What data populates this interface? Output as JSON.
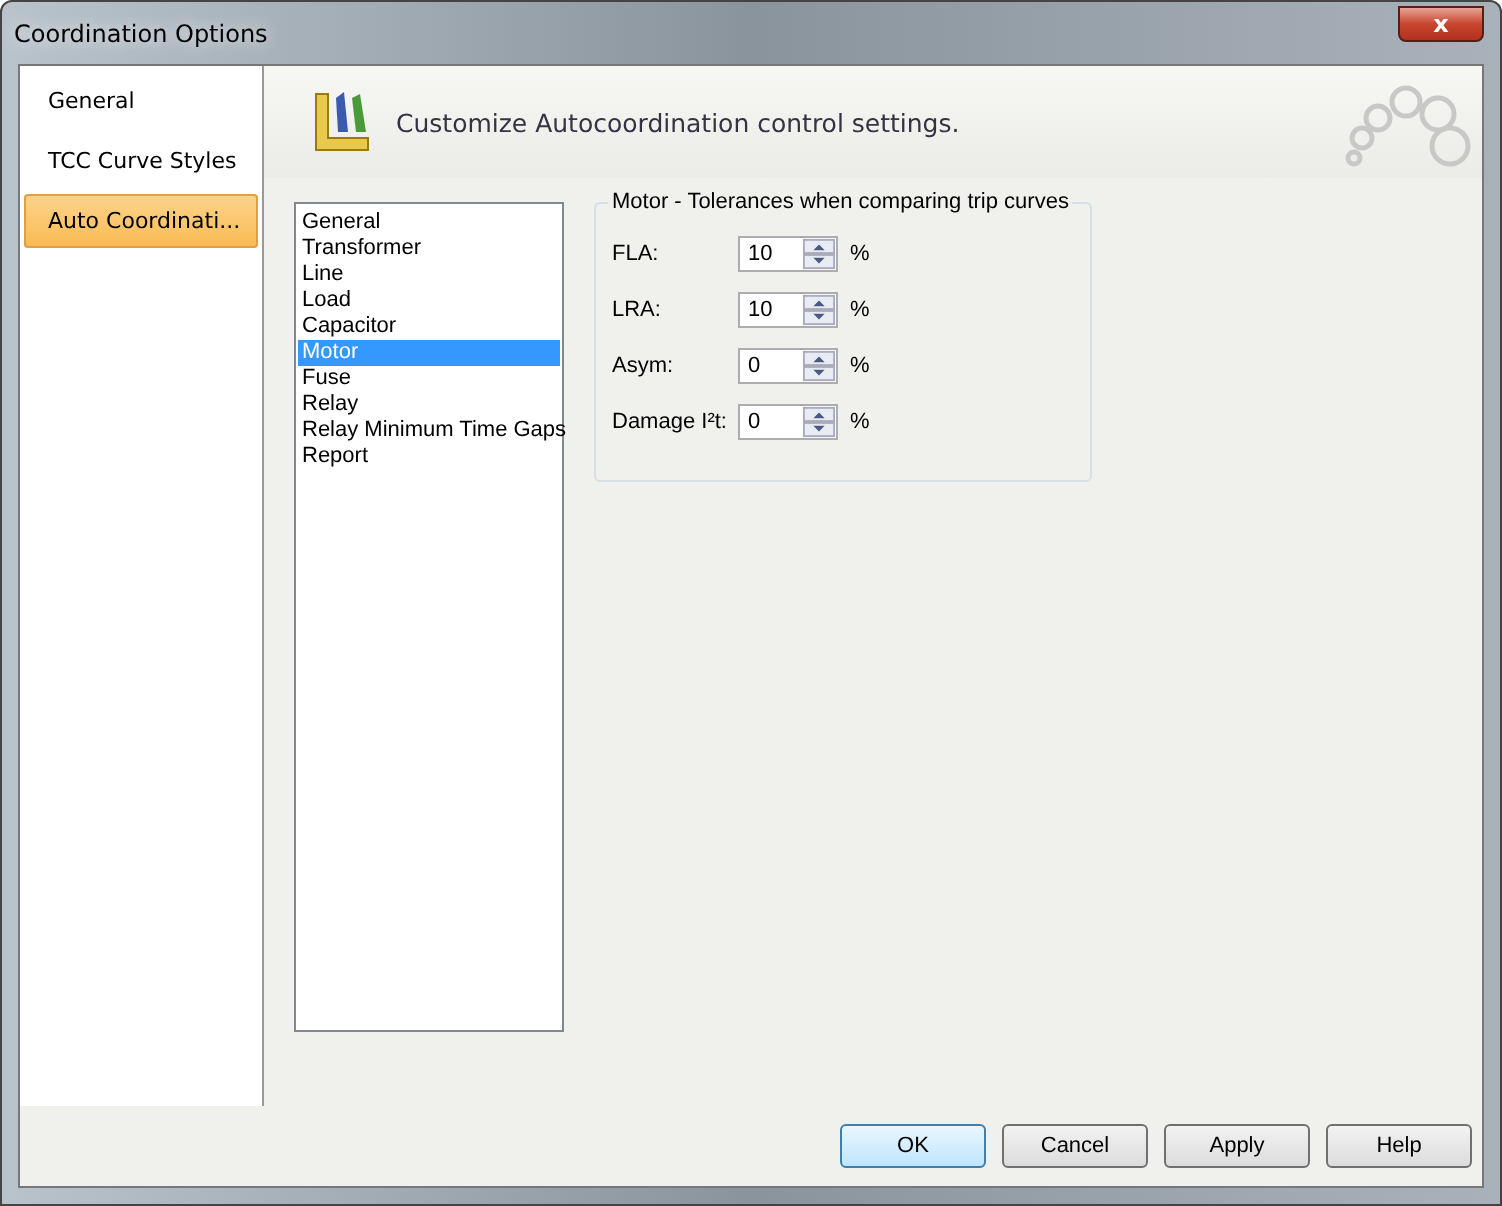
{
  "window": {
    "title": "Coordination Options",
    "close_label": "x"
  },
  "nav": [
    {
      "label": "General",
      "selected": false
    },
    {
      "label": "TCC Curve Styles",
      "selected": false
    },
    {
      "label": "Auto Coordinati...",
      "selected": true
    }
  ],
  "header": {
    "text": "Customize Autocoordination control settings."
  },
  "categories": [
    {
      "label": "General",
      "selected": false
    },
    {
      "label": "Transformer",
      "selected": false
    },
    {
      "label": "Line",
      "selected": false
    },
    {
      "label": "Load",
      "selected": false
    },
    {
      "label": "Capacitor",
      "selected": false
    },
    {
      "label": "Motor",
      "selected": true
    },
    {
      "label": "Fuse",
      "selected": false
    },
    {
      "label": "Relay",
      "selected": false
    },
    {
      "label": "Relay Minimum Time Gaps",
      "selected": false
    },
    {
      "label": "Report",
      "selected": false
    }
  ],
  "group": {
    "title": "Motor - Tolerances when comparing trip curves",
    "fields": [
      {
        "label": "FLA:",
        "value": "10",
        "unit": "%"
      },
      {
        "label": "LRA:",
        "value": "10",
        "unit": "%"
      },
      {
        "label": "Asym:",
        "value": "0",
        "unit": "%"
      },
      {
        "label": "Damage I²t:",
        "value": "0",
        "unit": "%"
      }
    ]
  },
  "buttons": [
    {
      "label": "OK",
      "default": true
    },
    {
      "label": "Cancel",
      "default": false
    },
    {
      "label": "Apply",
      "default": false
    },
    {
      "label": "Help",
      "default": false
    }
  ]
}
